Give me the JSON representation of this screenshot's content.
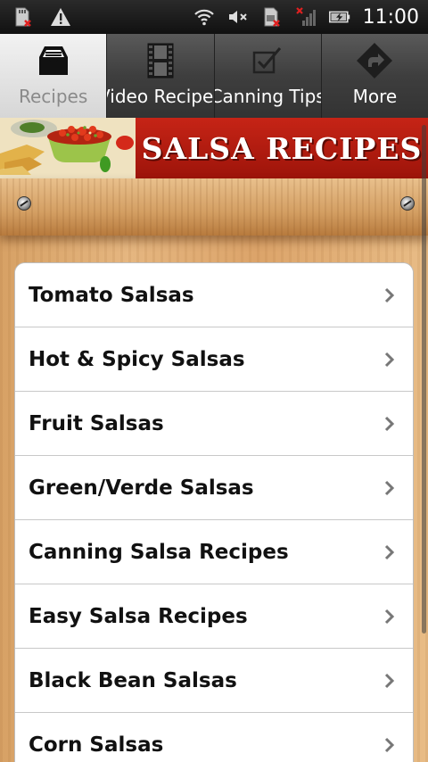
{
  "status_bar": {
    "time": "11:00",
    "icons": [
      "sd-card-error-icon",
      "warning-icon",
      "wifi-icon",
      "mute-icon",
      "sim-error-icon",
      "no-signal-icon",
      "battery-charging-icon"
    ]
  },
  "tabs": [
    {
      "label": "Recipes",
      "icon": "inbox-tray-icon",
      "active": true
    },
    {
      "label": "Video Recipes",
      "icon": "film-icon",
      "active": false
    },
    {
      "label": "Canning Tips",
      "icon": "checkbox-icon",
      "active": false
    },
    {
      "label": "More",
      "icon": "more-arrow-icon",
      "active": false
    }
  ],
  "banner": {
    "title": "SALSA RECIPES"
  },
  "colors": {
    "banner_red": "#b41a0e",
    "wood": "#e0ad72",
    "active_tab": "#e6e6e6"
  },
  "list": {
    "items": [
      {
        "label": "Tomato Salsas"
      },
      {
        "label": "Hot & Spicy Salsas"
      },
      {
        "label": "Fruit Salsas"
      },
      {
        "label": "Green/Verde Salsas"
      },
      {
        "label": "Canning Salsa Recipes"
      },
      {
        "label": "Easy Salsa Recipes"
      },
      {
        "label": "Black Bean Salsas"
      },
      {
        "label": "Corn Salsas"
      }
    ]
  }
}
